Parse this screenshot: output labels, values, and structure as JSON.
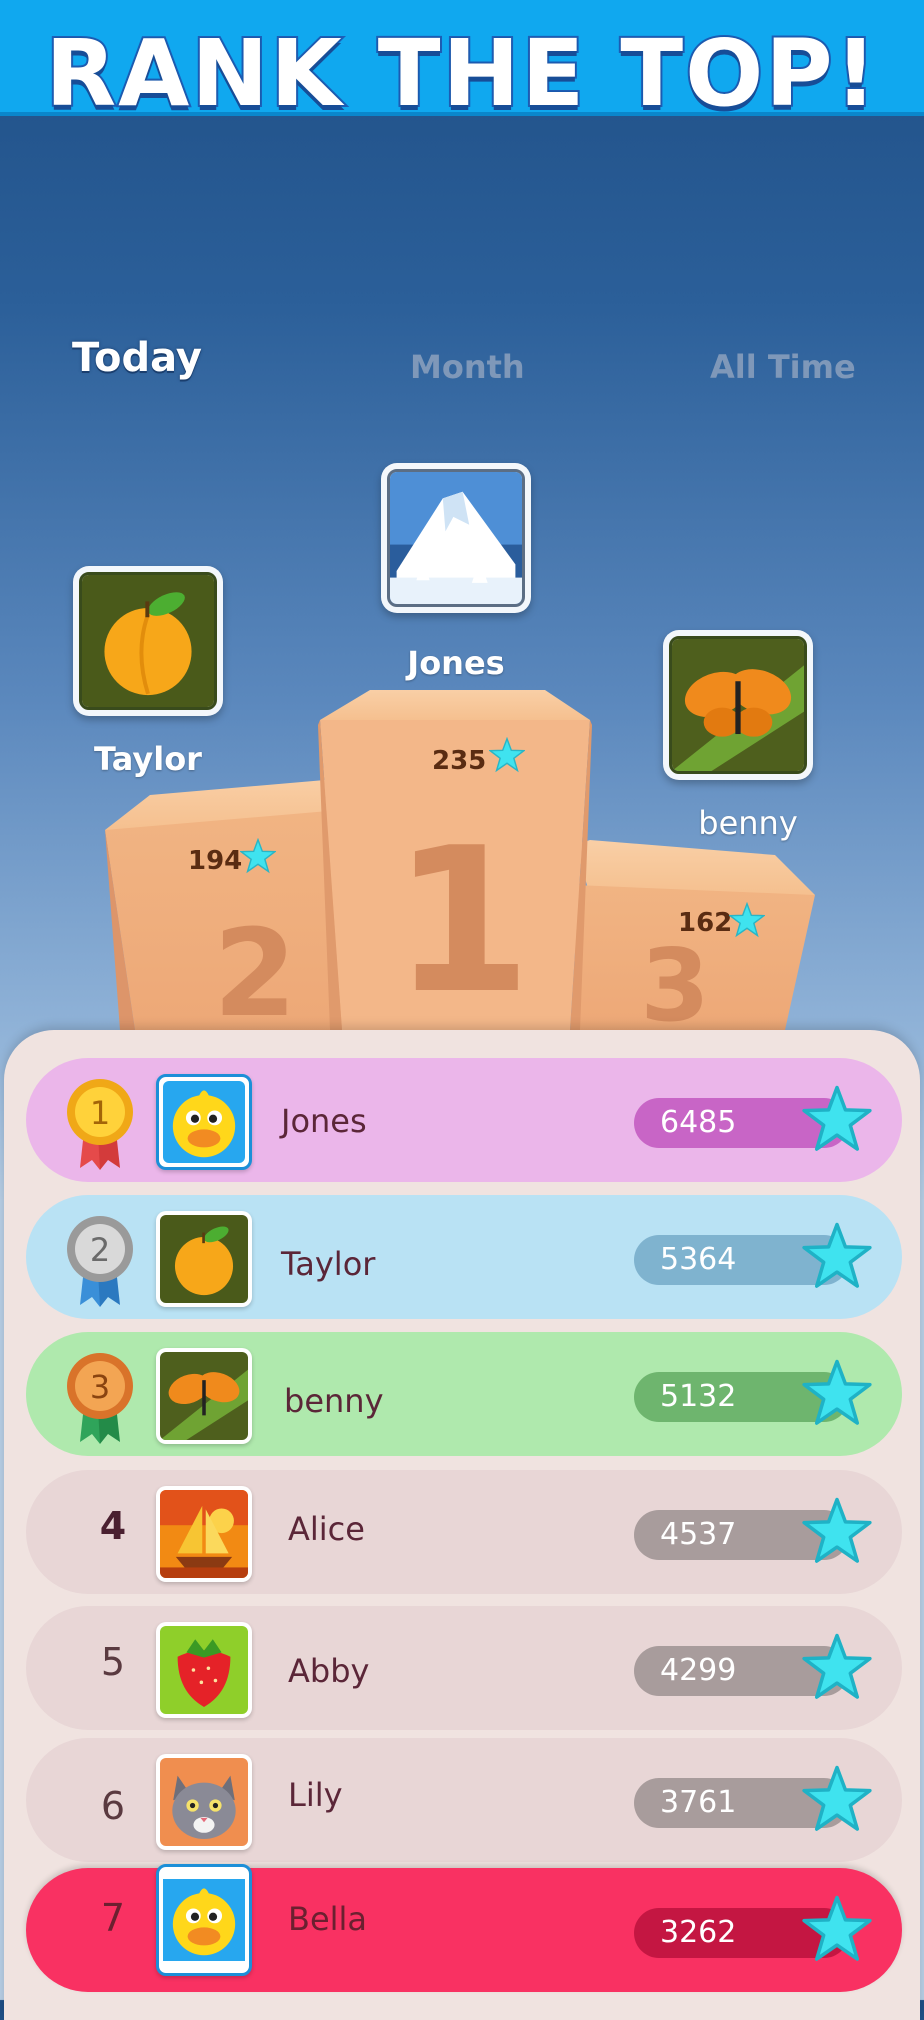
{
  "header": {
    "title": "RANK THE TOP!"
  },
  "tabs": [
    {
      "label": "Today",
      "active": true
    },
    {
      "label": "Month",
      "active": false
    },
    {
      "label": "All Time",
      "active": false
    }
  ],
  "podium": {
    "first": {
      "name": "Jones",
      "score": "235",
      "place": "1",
      "icon": "snow-mountain-icon"
    },
    "second": {
      "name": "Taylor",
      "score": "194",
      "place": "2",
      "icon": "peach-icon"
    },
    "third": {
      "name": "benny",
      "score": "162",
      "place": "3",
      "icon": "butterfly-icon"
    }
  },
  "leaderboard": [
    {
      "rank": "1",
      "name": "Jones",
      "score": "6485",
      "icon": "duck-icon",
      "medal": "gold"
    },
    {
      "rank": "2",
      "name": "Taylor",
      "score": "5364",
      "icon": "peach-icon",
      "medal": "silver"
    },
    {
      "rank": "3",
      "name": "benny",
      "score": "5132",
      "icon": "butterfly-icon",
      "medal": "bronze"
    },
    {
      "rank": "4",
      "name": "Alice",
      "score": "4537",
      "icon": "sailboat-icon"
    },
    {
      "rank": "5",
      "name": "Abby",
      "score": "4299",
      "icon": "strawberry-icon"
    },
    {
      "rank": "6",
      "name": "Lily",
      "score": "3761",
      "icon": "cat-icon"
    },
    {
      "rank": "7",
      "name": "Bella",
      "score": "3262",
      "icon": "duck-icon",
      "highlight": true
    }
  ],
  "colors": {
    "topbar": "#10a8ef",
    "row1": "#ebb6ea",
    "row2": "#b9e2f4",
    "row3": "#afe9ad",
    "row_default": "#e8d6d6",
    "row_self": "#f93162",
    "star": "#3fe3ef"
  }
}
